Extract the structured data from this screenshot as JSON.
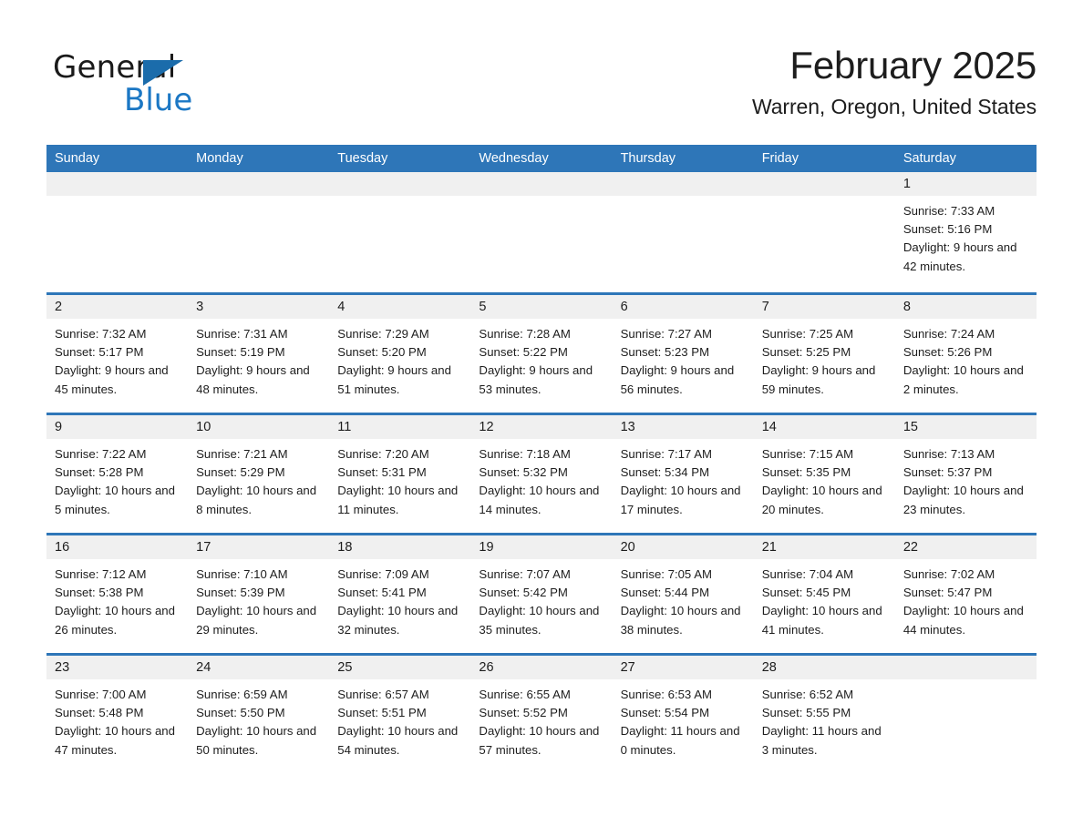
{
  "brand": {
    "name_part1": "General",
    "name_part2": "Blue",
    "accent_color": "#1b77c4",
    "triangle_color": "#1b6cab"
  },
  "header": {
    "title": "February 2025",
    "subtitle": "Warren, Oregon, United States"
  },
  "theme": {
    "header_bar_color": "#2e76b8",
    "day_band_color": "#f0f0f0",
    "row_border_color": "#2e76b8"
  },
  "calendar": {
    "day_names": [
      "Sunday",
      "Monday",
      "Tuesday",
      "Wednesday",
      "Thursday",
      "Friday",
      "Saturday"
    ],
    "labels": {
      "sunrise": "Sunrise:",
      "sunset": "Sunset:",
      "daylight": "Daylight:"
    },
    "weeks": [
      [
        {
          "day": "",
          "empty": true
        },
        {
          "day": "",
          "empty": true
        },
        {
          "day": "",
          "empty": true
        },
        {
          "day": "",
          "empty": true
        },
        {
          "day": "",
          "empty": true
        },
        {
          "day": "",
          "empty": true
        },
        {
          "day": "1",
          "sunrise": "Sunrise: 7:33 AM",
          "sunset": "Sunset: 5:16 PM",
          "daylight": "Daylight: 9 hours and 42 minutes."
        }
      ],
      [
        {
          "day": "2",
          "sunrise": "Sunrise: 7:32 AM",
          "sunset": "Sunset: 5:17 PM",
          "daylight": "Daylight: 9 hours and 45 minutes."
        },
        {
          "day": "3",
          "sunrise": "Sunrise: 7:31 AM",
          "sunset": "Sunset: 5:19 PM",
          "daylight": "Daylight: 9 hours and 48 minutes."
        },
        {
          "day": "4",
          "sunrise": "Sunrise: 7:29 AM",
          "sunset": "Sunset: 5:20 PM",
          "daylight": "Daylight: 9 hours and 51 minutes."
        },
        {
          "day": "5",
          "sunrise": "Sunrise: 7:28 AM",
          "sunset": "Sunset: 5:22 PM",
          "daylight": "Daylight: 9 hours and 53 minutes."
        },
        {
          "day": "6",
          "sunrise": "Sunrise: 7:27 AM",
          "sunset": "Sunset: 5:23 PM",
          "daylight": "Daylight: 9 hours and 56 minutes."
        },
        {
          "day": "7",
          "sunrise": "Sunrise: 7:25 AM",
          "sunset": "Sunset: 5:25 PM",
          "daylight": "Daylight: 9 hours and 59 minutes."
        },
        {
          "day": "8",
          "sunrise": "Sunrise: 7:24 AM",
          "sunset": "Sunset: 5:26 PM",
          "daylight": "Daylight: 10 hours and 2 minutes."
        }
      ],
      [
        {
          "day": "9",
          "sunrise": "Sunrise: 7:22 AM",
          "sunset": "Sunset: 5:28 PM",
          "daylight": "Daylight: 10 hours and 5 minutes."
        },
        {
          "day": "10",
          "sunrise": "Sunrise: 7:21 AM",
          "sunset": "Sunset: 5:29 PM",
          "daylight": "Daylight: 10 hours and 8 minutes."
        },
        {
          "day": "11",
          "sunrise": "Sunrise: 7:20 AM",
          "sunset": "Sunset: 5:31 PM",
          "daylight": "Daylight: 10 hours and 11 minutes."
        },
        {
          "day": "12",
          "sunrise": "Sunrise: 7:18 AM",
          "sunset": "Sunset: 5:32 PM",
          "daylight": "Daylight: 10 hours and 14 minutes."
        },
        {
          "day": "13",
          "sunrise": "Sunrise: 7:17 AM",
          "sunset": "Sunset: 5:34 PM",
          "daylight": "Daylight: 10 hours and 17 minutes."
        },
        {
          "day": "14",
          "sunrise": "Sunrise: 7:15 AM",
          "sunset": "Sunset: 5:35 PM",
          "daylight": "Daylight: 10 hours and 20 minutes."
        },
        {
          "day": "15",
          "sunrise": "Sunrise: 7:13 AM",
          "sunset": "Sunset: 5:37 PM",
          "daylight": "Daylight: 10 hours and 23 minutes."
        }
      ],
      [
        {
          "day": "16",
          "sunrise": "Sunrise: 7:12 AM",
          "sunset": "Sunset: 5:38 PM",
          "daylight": "Daylight: 10 hours and 26 minutes."
        },
        {
          "day": "17",
          "sunrise": "Sunrise: 7:10 AM",
          "sunset": "Sunset: 5:39 PM",
          "daylight": "Daylight: 10 hours and 29 minutes."
        },
        {
          "day": "18",
          "sunrise": "Sunrise: 7:09 AM",
          "sunset": "Sunset: 5:41 PM",
          "daylight": "Daylight: 10 hours and 32 minutes."
        },
        {
          "day": "19",
          "sunrise": "Sunrise: 7:07 AM",
          "sunset": "Sunset: 5:42 PM",
          "daylight": "Daylight: 10 hours and 35 minutes."
        },
        {
          "day": "20",
          "sunrise": "Sunrise: 7:05 AM",
          "sunset": "Sunset: 5:44 PM",
          "daylight": "Daylight: 10 hours and 38 minutes."
        },
        {
          "day": "21",
          "sunrise": "Sunrise: 7:04 AM",
          "sunset": "Sunset: 5:45 PM",
          "daylight": "Daylight: 10 hours and 41 minutes."
        },
        {
          "day": "22",
          "sunrise": "Sunrise: 7:02 AM",
          "sunset": "Sunset: 5:47 PM",
          "daylight": "Daylight: 10 hours and 44 minutes."
        }
      ],
      [
        {
          "day": "23",
          "sunrise": "Sunrise: 7:00 AM",
          "sunset": "Sunset: 5:48 PM",
          "daylight": "Daylight: 10 hours and 47 minutes."
        },
        {
          "day": "24",
          "sunrise": "Sunrise: 6:59 AM",
          "sunset": "Sunset: 5:50 PM",
          "daylight": "Daylight: 10 hours and 50 minutes."
        },
        {
          "day": "25",
          "sunrise": "Sunrise: 6:57 AM",
          "sunset": "Sunset: 5:51 PM",
          "daylight": "Daylight: 10 hours and 54 minutes."
        },
        {
          "day": "26",
          "sunrise": "Sunrise: 6:55 AM",
          "sunset": "Sunset: 5:52 PM",
          "daylight": "Daylight: 10 hours and 57 minutes."
        },
        {
          "day": "27",
          "sunrise": "Sunrise: 6:53 AM",
          "sunset": "Sunset: 5:54 PM",
          "daylight": "Daylight: 11 hours and 0 minutes."
        },
        {
          "day": "28",
          "sunrise": "Sunrise: 6:52 AM",
          "sunset": "Sunset: 5:55 PM",
          "daylight": "Daylight: 11 hours and 3 minutes."
        },
        {
          "day": "",
          "empty": true
        }
      ]
    ]
  }
}
